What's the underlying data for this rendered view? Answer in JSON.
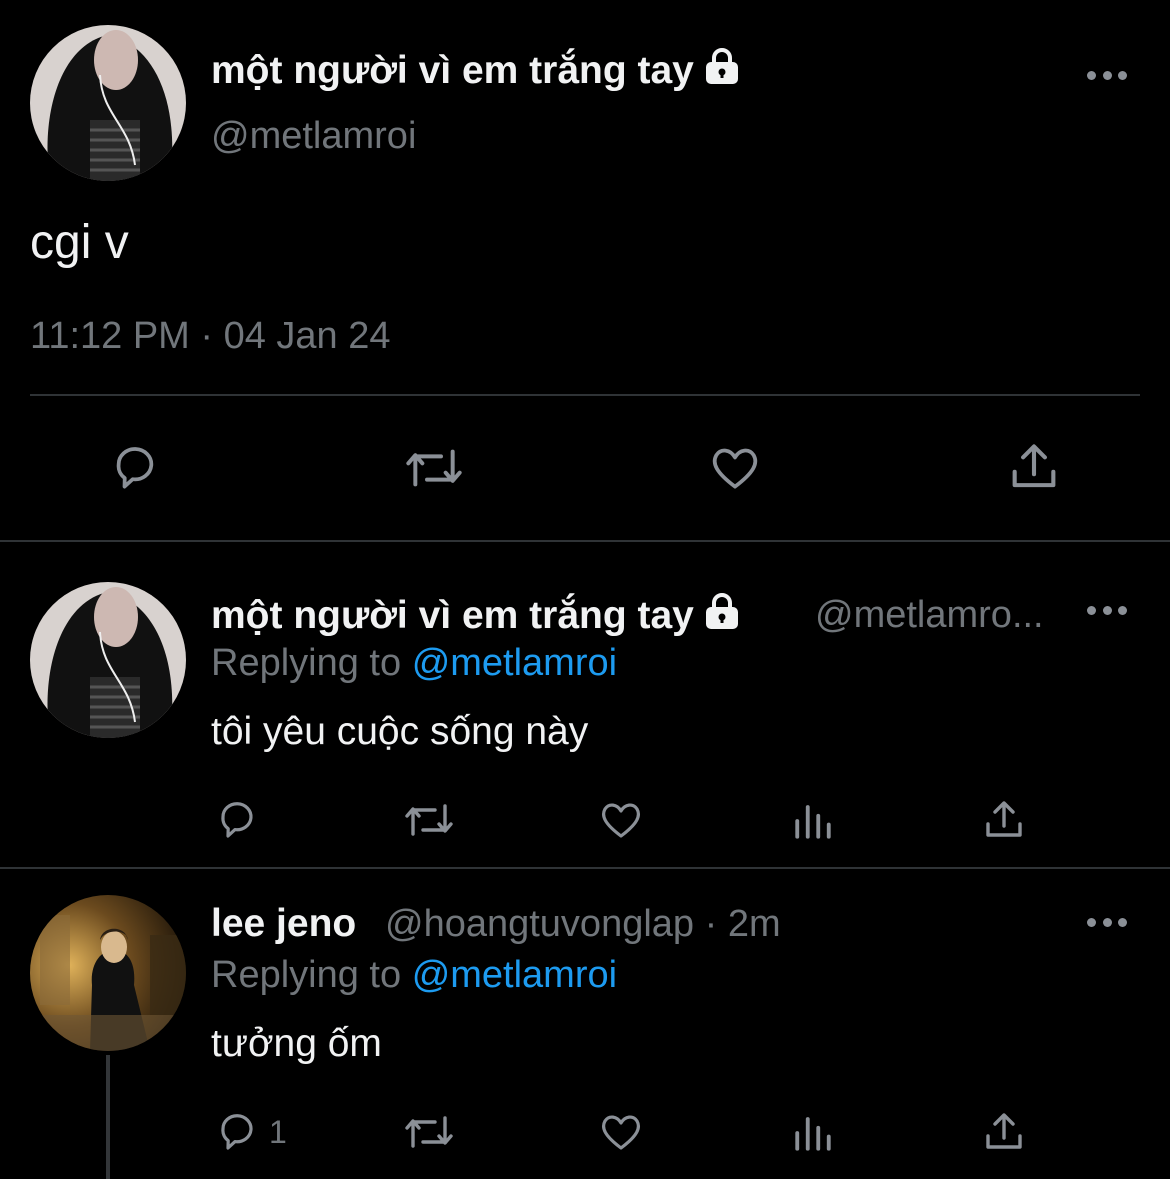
{
  "main_tweet": {
    "author_name": "một người vì em trắng tay",
    "handle": "@metlamroi",
    "text": "cgi v",
    "timestamp": "11:12 PM · 04 Jan 24"
  },
  "replies": [
    {
      "author_name": "một người vì em trắng tay",
      "handle_truncated": "@metlamro...",
      "replying_label": "Replying to",
      "replying_to": "@metlamroi",
      "text": "tôi yêu cuộc sống này",
      "reply_count": ""
    },
    {
      "author_name": "lee jeno",
      "handle_time": "@hoangtuvonglap · 2m",
      "replying_label": "Replying to",
      "replying_to": "@metlamroi",
      "text": "tưởng ốm",
      "reply_count": "1"
    }
  ],
  "colors": {
    "background": "#000000",
    "text_primary": "#f1f2f3",
    "text_secondary": "#71767b",
    "accent": "#1d9bf0",
    "divider": "#2f3336"
  },
  "icons": [
    "reply-icon",
    "retweet-icon",
    "like-icon",
    "share-icon",
    "analytics-icon",
    "lock-icon",
    "more-icon"
  ]
}
